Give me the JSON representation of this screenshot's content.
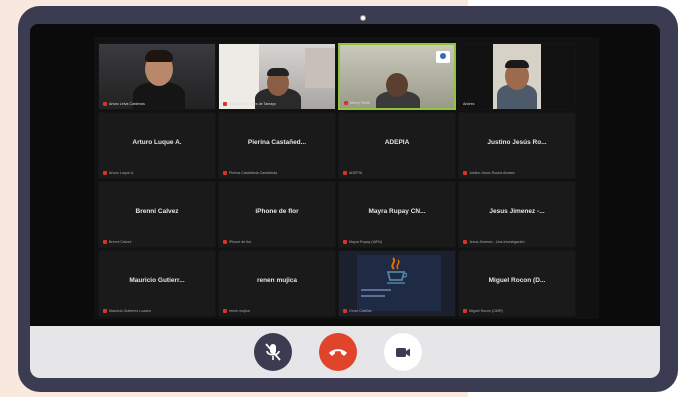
{
  "tiles": [
    {
      "name": "",
      "caption": "Arturo Leiva Cardenas",
      "kind": "video-person"
    },
    {
      "name": "",
      "caption": "Enrique Gonzales de Tamayo",
      "kind": "video-office"
    },
    {
      "name": "",
      "caption": "Mercy Ponte",
      "kind": "video-bald"
    },
    {
      "name": "",
      "caption": "Andres",
      "kind": "video-man"
    },
    {
      "name": "Arturo Luque A.",
      "caption": "Arturo Luque A."
    },
    {
      "name": "Pierina Castañed...",
      "caption": "Pierina Castañeda Castañeda"
    },
    {
      "name": "ADEPIA",
      "caption": "ADEPIA"
    },
    {
      "name": "Justino Jesús Ro...",
      "caption": "Justino Jesús Rocha Alvarez"
    },
    {
      "name": "Brenni Calvez",
      "caption": "Brenni Calvez"
    },
    {
      "name": "iPhone de flor",
      "caption": "iPhone de flor"
    },
    {
      "name": "Mayra Rupay CN...",
      "caption": "Mayra Rupay (IAFN)"
    },
    {
      "name": "Jesus Jimenez -...",
      "caption": "Jesus Jimenez - Una Investigación"
    },
    {
      "name": "Mauricio Gutierr...",
      "caption": "Mauricio Gutierrez Lozano"
    },
    {
      "name": "renen mujica",
      "caption": "renen mujica"
    },
    {
      "name": "",
      "caption": "Omar Casillas",
      "kind": "video-java"
    },
    {
      "name": "Miguel Rocon (D...",
      "caption": "Miguel Rocon (OMR)"
    }
  ],
  "controls": {
    "mute": {
      "icon": "mic-off-icon",
      "color": "#3b3b52"
    },
    "end_call": {
      "icon": "phone-hangup-icon",
      "color": "#e0442a"
    },
    "video": {
      "icon": "video-camera-icon",
      "color": "#ffffff"
    }
  },
  "colors": {
    "frame": "#3b3b52",
    "background_left": "#f8e8de",
    "active_speaker_border": "#8fc43c"
  }
}
